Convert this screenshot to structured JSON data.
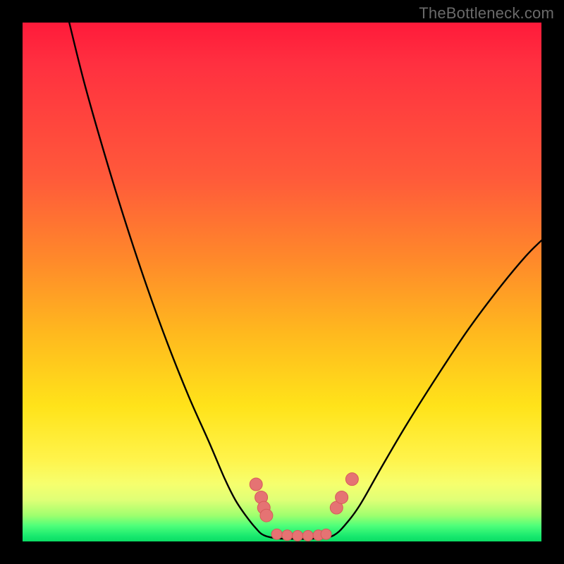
{
  "watermark": "TheBottleneck.com",
  "chart_data": {
    "type": "line",
    "title": "",
    "xlabel": "",
    "ylabel": "",
    "xlim": [
      0,
      100
    ],
    "ylim": [
      0,
      100
    ],
    "grid": false,
    "legend": false,
    "annotations": [],
    "series": [
      {
        "name": "left-curve",
        "x": [
          9,
          12,
          16,
          20,
          24,
          28,
          32,
          36,
          39,
          41,
          43,
          45,
          46.5
        ],
        "y": [
          100,
          88,
          74,
          61,
          49,
          38,
          28,
          19,
          12,
          8,
          5,
          2.5,
          1.2
        ]
      },
      {
        "name": "right-curve",
        "x": [
          60,
          62,
          65,
          69,
          74,
          80,
          86,
          92,
          97,
          100
        ],
        "y": [
          1.2,
          3,
          7,
          14,
          22.5,
          32,
          41,
          49,
          55,
          58
        ]
      },
      {
        "name": "valley-floor",
        "x": [
          46.5,
          49,
          52,
          55,
          58,
          60
        ],
        "y": [
          1.2,
          0.6,
          0.5,
          0.5,
          0.7,
          1.2
        ]
      }
    ],
    "markers": [
      {
        "name": "left-cluster",
        "points": [
          [
            45,
            11
          ],
          [
            46,
            8.5
          ],
          [
            46.5,
            6.5
          ],
          [
            47,
            5
          ]
        ]
      },
      {
        "name": "right-cluster",
        "points": [
          [
            60.5,
            6.5
          ],
          [
            61.5,
            8.5
          ],
          [
            63.5,
            12
          ]
        ]
      },
      {
        "name": "bottom-run",
        "points": [
          [
            49,
            1.4
          ],
          [
            51,
            1.2
          ],
          [
            53,
            1.1
          ],
          [
            55,
            1.1
          ],
          [
            57,
            1.2
          ],
          [
            58.5,
            1.4
          ]
        ]
      }
    ],
    "colors": {
      "curve": "#000000",
      "marker_fill": "#e57373",
      "marker_stroke": "#d65a5a"
    }
  }
}
